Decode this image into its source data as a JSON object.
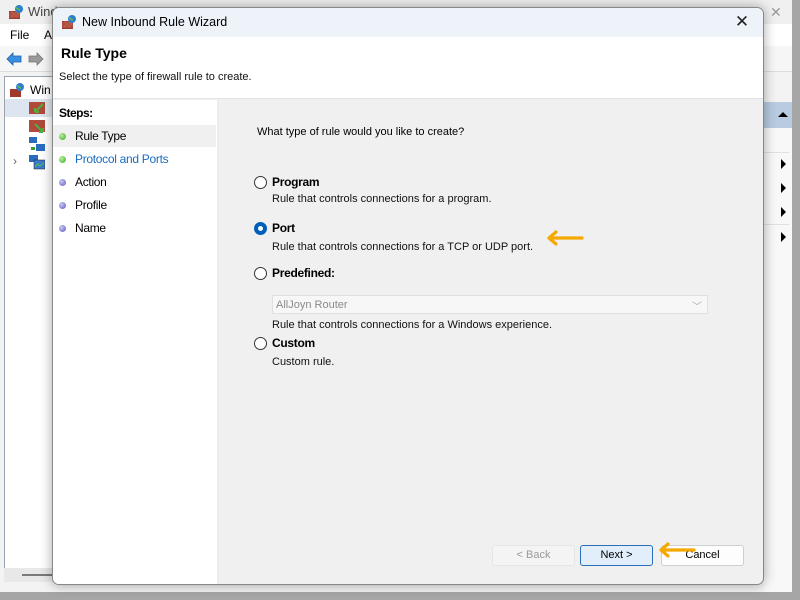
{
  "background_window": {
    "title": "Windows Defender Firewall with Advanced Security",
    "title_visible": "Wind",
    "menu": [
      "File",
      "A"
    ],
    "tree_root_label": "Win",
    "actions_arrows": 4
  },
  "dialog": {
    "title": "New Inbound Rule Wizard",
    "close_label": "✕",
    "heading": "Rule Type",
    "subheading": "Select the type of firewall rule to create.",
    "steps_title": "Steps:",
    "steps": [
      {
        "label": "Rule Type",
        "status": "done",
        "current": true
      },
      {
        "label": "Protocol and Ports",
        "status": "done",
        "current": false
      },
      {
        "label": "Action",
        "status": "todo",
        "current": false
      },
      {
        "label": "Profile",
        "status": "todo",
        "current": false
      },
      {
        "label": "Name",
        "status": "todo",
        "current": false
      }
    ],
    "question": "What type of rule would you like to create?",
    "options": [
      {
        "label": "Program",
        "description": "Rule that controls connections for a program.",
        "checked": false
      },
      {
        "label": "Port",
        "description": "Rule that controls connections for a TCP or UDP port.",
        "checked": true
      },
      {
        "label": "Predefined:",
        "description": "Rule that controls connections for a Windows experience.",
        "checked": false
      },
      {
        "label": "Custom",
        "description": "Custom rule.",
        "checked": false
      }
    ],
    "predefined_select": {
      "value": "AllJoyn Router",
      "disabled": true
    },
    "buttons": {
      "back": "< Back",
      "next": "Next >",
      "cancel": "Cancel"
    }
  },
  "colors": {
    "accent": "#005fb8",
    "annotation_arrow": "#f5a800",
    "step_link": "#1a6bc0"
  }
}
